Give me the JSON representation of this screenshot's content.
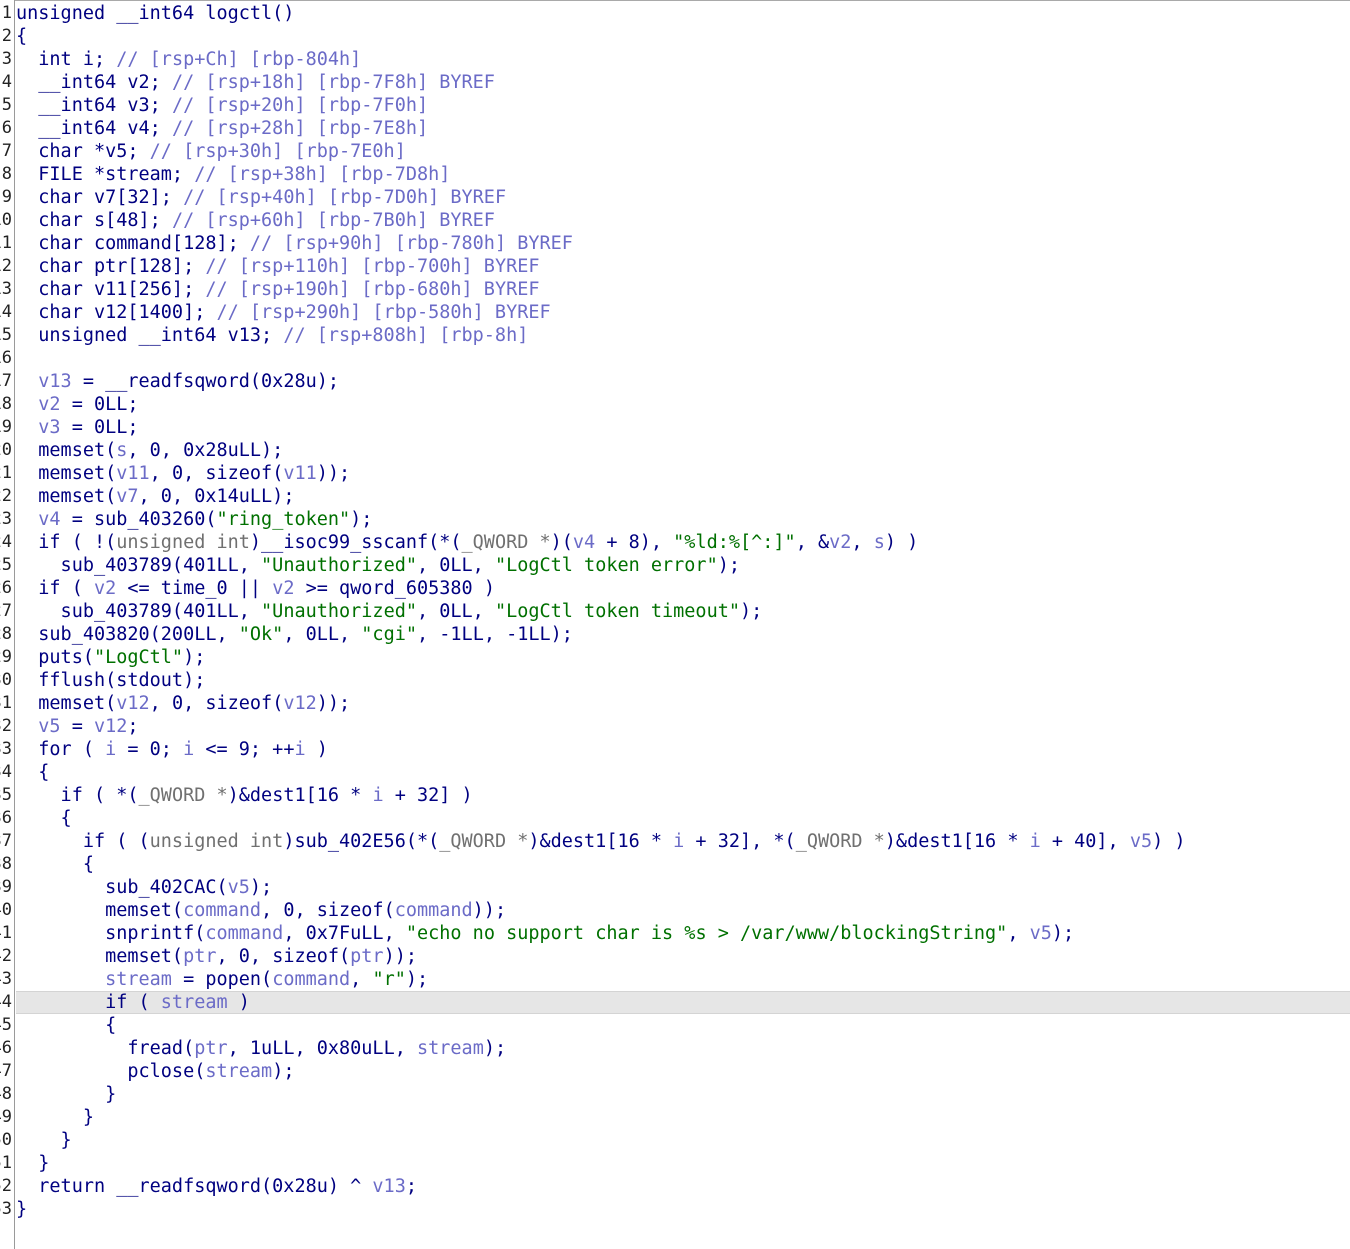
{
  "code_view": {
    "highlighted_line": 44,
    "lines": [
      [
        [
          "k",
          "unsigned __int64 logctl()"
        ]
      ],
      [
        [
          "k",
          "{"
        ]
      ],
      [
        [
          "k",
          "  int i; "
        ],
        [
          "c",
          "// [rsp+Ch] [rbp-804h]"
        ]
      ],
      [
        [
          "k",
          "  __int64 v2; "
        ],
        [
          "c",
          "// [rsp+18h] [rbp-7F8h] BYREF"
        ]
      ],
      [
        [
          "k",
          "  __int64 v3; "
        ],
        [
          "c",
          "// [rsp+20h] [rbp-7F0h]"
        ]
      ],
      [
        [
          "k",
          "  __int64 v4; "
        ],
        [
          "c",
          "// [rsp+28h] [rbp-7E8h]"
        ]
      ],
      [
        [
          "k",
          "  char *v5; "
        ],
        [
          "c",
          "// [rsp+30h] [rbp-7E0h]"
        ]
      ],
      [
        [
          "k",
          "  FILE *stream; "
        ],
        [
          "c",
          "// [rsp+38h] [rbp-7D8h]"
        ]
      ],
      [
        [
          "k",
          "  char v7[32]; "
        ],
        [
          "c",
          "// [rsp+40h] [rbp-7D0h] BYREF"
        ]
      ],
      [
        [
          "k",
          "  char s[48]; "
        ],
        [
          "c",
          "// [rsp+60h] [rbp-7B0h] BYREF"
        ]
      ],
      [
        [
          "k",
          "  char command[128]; "
        ],
        [
          "c",
          "// [rsp+90h] [rbp-780h] BYREF"
        ]
      ],
      [
        [
          "k",
          "  char ptr[128]; "
        ],
        [
          "c",
          "// [rsp+110h] [rbp-700h] BYREF"
        ]
      ],
      [
        [
          "k",
          "  char v11[256]; "
        ],
        [
          "c",
          "// [rsp+190h] [rbp-680h] BYREF"
        ]
      ],
      [
        [
          "k",
          "  char v12[1400]; "
        ],
        [
          "c",
          "// [rsp+290h] [rbp-580h] BYREF"
        ]
      ],
      [
        [
          "k",
          "  unsigned __int64 v13; "
        ],
        [
          "c",
          "// [rsp+808h] [rbp-8h]"
        ]
      ],
      [],
      [
        [
          "k",
          "  "
        ],
        [
          "v",
          "v13"
        ],
        [
          "k",
          " = __readfsqword(0x28u);"
        ]
      ],
      [
        [
          "k",
          "  "
        ],
        [
          "v",
          "v2"
        ],
        [
          "k",
          " = 0LL;"
        ]
      ],
      [
        [
          "k",
          "  "
        ],
        [
          "v",
          "v3"
        ],
        [
          "k",
          " = 0LL;"
        ]
      ],
      [
        [
          "k",
          "  memset("
        ],
        [
          "v",
          "s"
        ],
        [
          "k",
          ", 0, 0x28uLL);"
        ]
      ],
      [
        [
          "k",
          "  memset("
        ],
        [
          "v",
          "v11"
        ],
        [
          "k",
          ", 0, sizeof("
        ],
        [
          "v",
          "v11"
        ],
        [
          "k",
          "));"
        ]
      ],
      [
        [
          "k",
          "  memset("
        ],
        [
          "v",
          "v7"
        ],
        [
          "k",
          ", 0, 0x14uLL);"
        ]
      ],
      [
        [
          "k",
          "  "
        ],
        [
          "v",
          "v4"
        ],
        [
          "k",
          " = sub_403260("
        ],
        [
          "s",
          "\"ring_token\""
        ],
        [
          "k",
          ");"
        ]
      ],
      [
        [
          "k",
          "  if ( !("
        ],
        [
          "g",
          "unsigned int"
        ],
        [
          "k",
          ")__isoc99_sscanf(*("
        ],
        [
          "g",
          "_QWORD *"
        ],
        [
          "k",
          ")("
        ],
        [
          "v",
          "v4"
        ],
        [
          "k",
          " + 8), "
        ],
        [
          "s",
          "\"%ld:%[^:]\""
        ],
        [
          "k",
          ", &"
        ],
        [
          "v",
          "v2"
        ],
        [
          "k",
          ", "
        ],
        [
          "v",
          "s"
        ],
        [
          "k",
          ") )"
        ]
      ],
      [
        [
          "k",
          "    sub_403789(401LL, "
        ],
        [
          "s",
          "\"Unauthorized\""
        ],
        [
          "k",
          ", 0LL, "
        ],
        [
          "s",
          "\"LogCtl token error\""
        ],
        [
          "k",
          ");"
        ]
      ],
      [
        [
          "k",
          "  if ( "
        ],
        [
          "v",
          "v2"
        ],
        [
          "k",
          " <= time_0 || "
        ],
        [
          "v",
          "v2"
        ],
        [
          "k",
          " >= qword_605380 )"
        ]
      ],
      [
        [
          "k",
          "    sub_403789(401LL, "
        ],
        [
          "s",
          "\"Unauthorized\""
        ],
        [
          "k",
          ", 0LL, "
        ],
        [
          "s",
          "\"LogCtl token timeout\""
        ],
        [
          "k",
          ");"
        ]
      ],
      [
        [
          "k",
          "  sub_403820(200LL, "
        ],
        [
          "s",
          "\"Ok\""
        ],
        [
          "k",
          ", 0LL, "
        ],
        [
          "s",
          "\"cgi\""
        ],
        [
          "k",
          ", -1LL, -1LL);"
        ]
      ],
      [
        [
          "k",
          "  puts("
        ],
        [
          "s",
          "\"LogCtl\""
        ],
        [
          "k",
          ");"
        ]
      ],
      [
        [
          "k",
          "  fflush(stdout);"
        ]
      ],
      [
        [
          "k",
          "  memset("
        ],
        [
          "v",
          "v12"
        ],
        [
          "k",
          ", 0, sizeof("
        ],
        [
          "v",
          "v12"
        ],
        [
          "k",
          "));"
        ]
      ],
      [
        [
          "k",
          "  "
        ],
        [
          "v",
          "v5"
        ],
        [
          "k",
          " = "
        ],
        [
          "v",
          "v12"
        ],
        [
          "k",
          ";"
        ]
      ],
      [
        [
          "k",
          "  for ( "
        ],
        [
          "v",
          "i"
        ],
        [
          "k",
          " = 0; "
        ],
        [
          "v",
          "i"
        ],
        [
          "k",
          " <= 9; ++"
        ],
        [
          "v",
          "i"
        ],
        [
          "k",
          " )"
        ]
      ],
      [
        [
          "k",
          "  {"
        ]
      ],
      [
        [
          "k",
          "    if ( *("
        ],
        [
          "g",
          "_QWORD *"
        ],
        [
          "k",
          ")&dest1[16 * "
        ],
        [
          "v",
          "i"
        ],
        [
          "k",
          " + 32] )"
        ]
      ],
      [
        [
          "k",
          "    {"
        ]
      ],
      [
        [
          "k",
          "      if ( ("
        ],
        [
          "g",
          "unsigned int"
        ],
        [
          "k",
          ")sub_402E56(*("
        ],
        [
          "g",
          "_QWORD *"
        ],
        [
          "k",
          ")&dest1[16 * "
        ],
        [
          "v",
          "i"
        ],
        [
          "k",
          " + 32], *("
        ],
        [
          "g",
          "_QWORD *"
        ],
        [
          "k",
          ")&dest1[16 * "
        ],
        [
          "v",
          "i"
        ],
        [
          "k",
          " + 40], "
        ],
        [
          "v",
          "v5"
        ],
        [
          "k",
          ") )"
        ]
      ],
      [
        [
          "k",
          "      {"
        ]
      ],
      [
        [
          "k",
          "        sub_402CAC("
        ],
        [
          "v",
          "v5"
        ],
        [
          "k",
          ");"
        ]
      ],
      [
        [
          "k",
          "        memset("
        ],
        [
          "v",
          "command"
        ],
        [
          "k",
          ", 0, sizeof("
        ],
        [
          "v",
          "command"
        ],
        [
          "k",
          "));"
        ]
      ],
      [
        [
          "k",
          "        snprintf("
        ],
        [
          "v",
          "command"
        ],
        [
          "k",
          ", 0x7FuLL, "
        ],
        [
          "s",
          "\"echo no support char is %s > /var/www/blockingString\""
        ],
        [
          "k",
          ", "
        ],
        [
          "v",
          "v5"
        ],
        [
          "k",
          ");"
        ]
      ],
      [
        [
          "k",
          "        memset("
        ],
        [
          "v",
          "ptr"
        ],
        [
          "k",
          ", 0, sizeof("
        ],
        [
          "v",
          "ptr"
        ],
        [
          "k",
          "));"
        ]
      ],
      [
        [
          "k",
          "        "
        ],
        [
          "v",
          "stream"
        ],
        [
          "k",
          " = popen("
        ],
        [
          "v",
          "command"
        ],
        [
          "k",
          ", "
        ],
        [
          "s",
          "\"r\""
        ],
        [
          "k",
          ");"
        ]
      ],
      [
        [
          "k",
          "        if ( "
        ],
        [
          "v",
          "stream"
        ],
        [
          "k",
          " )"
        ]
      ],
      [
        [
          "k",
          "        {"
        ]
      ],
      [
        [
          "k",
          "          fread("
        ],
        [
          "v",
          "ptr"
        ],
        [
          "k",
          ", 1uLL, 0x80uLL, "
        ],
        [
          "v",
          "stream"
        ],
        [
          "k",
          ");"
        ]
      ],
      [
        [
          "k",
          "          pclose("
        ],
        [
          "v",
          "stream"
        ],
        [
          "k",
          ");"
        ]
      ],
      [
        [
          "k",
          "        }"
        ]
      ],
      [
        [
          "k",
          "      }"
        ]
      ],
      [
        [
          "k",
          "    }"
        ]
      ],
      [
        [
          "k",
          "  }"
        ]
      ],
      [
        [
          "k",
          "  return __readfsqword(0x28u) ^ "
        ],
        [
          "v",
          "v13"
        ],
        [
          "k",
          ";"
        ]
      ],
      [
        [
          "k",
          "}"
        ]
      ]
    ]
  }
}
